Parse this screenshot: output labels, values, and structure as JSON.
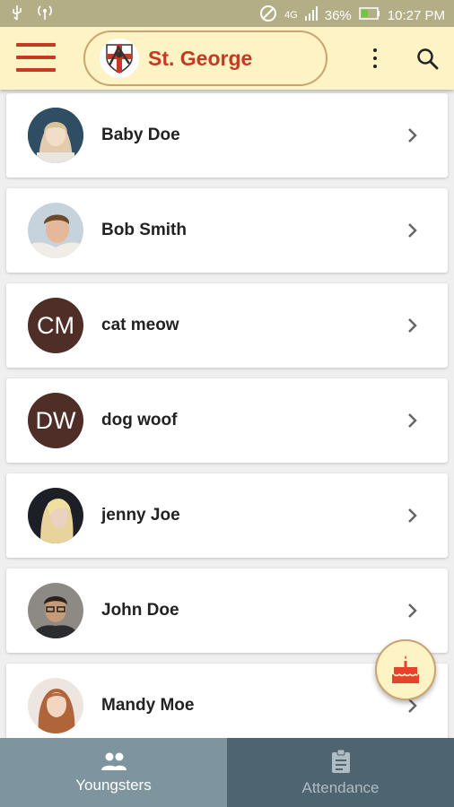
{
  "status_bar": {
    "network": "4G",
    "battery": "36%",
    "time": "10:27 PM"
  },
  "header": {
    "title": "St. George"
  },
  "youngsters": [
    {
      "name": "Baby Doe",
      "initials": "",
      "photo": true
    },
    {
      "name": "Bob Smith",
      "initials": "",
      "photo": true
    },
    {
      "name": "cat meow",
      "initials": "CM",
      "photo": false
    },
    {
      "name": "dog woof",
      "initials": "DW",
      "photo": false
    },
    {
      "name": "jenny Joe",
      "initials": "",
      "photo": true
    },
    {
      "name": "John Doe",
      "initials": "",
      "photo": true
    },
    {
      "name": "Mandy Moe",
      "initials": "",
      "photo": true
    }
  ],
  "bottom_nav": {
    "tabs": [
      {
        "label": "Youngsters",
        "active": true
      },
      {
        "label": "Attendance",
        "active": false
      }
    ]
  },
  "colors": {
    "app_bar": "#fdf3c4",
    "accent": "#c23b22",
    "initials_avatar": "#4e2e26"
  }
}
